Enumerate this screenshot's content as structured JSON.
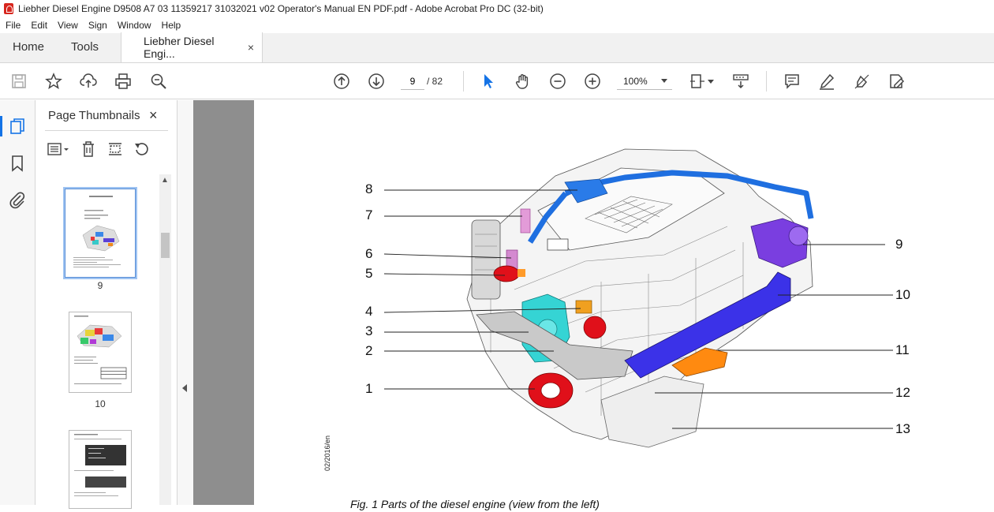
{
  "window": {
    "title": "Liebher Diesel Engine D9508 A7 03 11359217 31032021 v02 Operator's Manual EN PDF.pdf - Adobe Acrobat Pro DC (32-bit)"
  },
  "menu": [
    "File",
    "Edit",
    "View",
    "Sign",
    "Window",
    "Help"
  ],
  "tabs": {
    "home": "Home",
    "tools": "Tools",
    "document": "Liebher Diesel Engi...",
    "close": "×"
  },
  "toolbar": {
    "page_current": "9",
    "page_total": "/ 82",
    "zoom": "100%"
  },
  "thumbnails": {
    "title": "Page Thumbnails",
    "close": "×",
    "pages": [
      {
        "label": "9",
        "selected": true
      },
      {
        "label": "10",
        "selected": false
      },
      {
        "label": "",
        "selected": false
      }
    ]
  },
  "figure": {
    "callouts_left": [
      "8",
      "7",
      "6",
      "5",
      "4",
      "3",
      "2",
      "1"
    ],
    "callouts_right": [
      "9",
      "10",
      "11",
      "12",
      "13"
    ],
    "side_stamp": "02/2016/en",
    "caption": "Fig. 1  Parts of the diesel engine (view from the left)"
  },
  "colors": {
    "accent": "#1473e6",
    "doc_bg": "#8e8e8e",
    "acrobat_red": "#d7261e"
  }
}
